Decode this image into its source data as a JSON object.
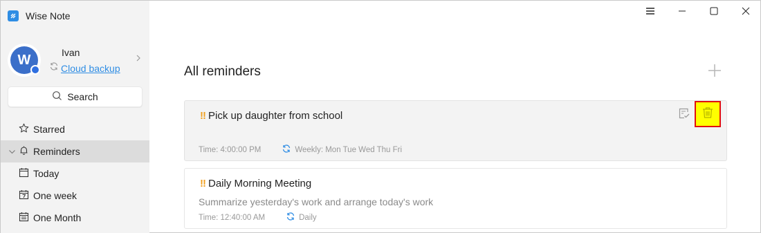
{
  "app": {
    "title": "Wise Note",
    "logo_color": "#2f8de4",
    "accent_color": "#2f8de4",
    "priority_color": "#f0a020"
  },
  "profile": {
    "avatar_letter": "W",
    "name": "Ivan",
    "cloud_label": "Cloud backup"
  },
  "search": {
    "label": "Search",
    "icon": "search-icon"
  },
  "nav": {
    "items": [
      {
        "label": "Starred",
        "icon": "star-icon"
      },
      {
        "label": "Reminders",
        "icon": "bell-icon",
        "active": true,
        "expanded": true
      },
      {
        "label": "Today",
        "icon": "calendar-icon"
      },
      {
        "label": "One week",
        "icon": "calendar-week-icon"
      },
      {
        "label": "One Month",
        "icon": "calendar-month-icon"
      }
    ]
  },
  "window_controls": {
    "menu_icon": "menu-icon",
    "minimize_icon": "minimize-icon",
    "maximize_icon": "maximize-icon",
    "close_icon": "close-icon"
  },
  "main": {
    "title": "All reminders",
    "add_icon": "plus-icon",
    "reminders": [
      {
        "priority": "!!",
        "title": "Pick up daughter from school",
        "description": "",
        "time": "Time: 4:00:00 PM",
        "repeat": "Weekly: Mon Tue Wed Thu Fri",
        "selected": true,
        "actions": [
          "mark-done-icon",
          "trash-icon"
        ]
      },
      {
        "priority": "!!",
        "title": "Daily Morning Meeting",
        "description": "Summarize yesterday's work and arrange today's work",
        "time": "Time: 12:40:00 AM",
        "repeat": "Daily",
        "selected": false
      }
    ]
  }
}
